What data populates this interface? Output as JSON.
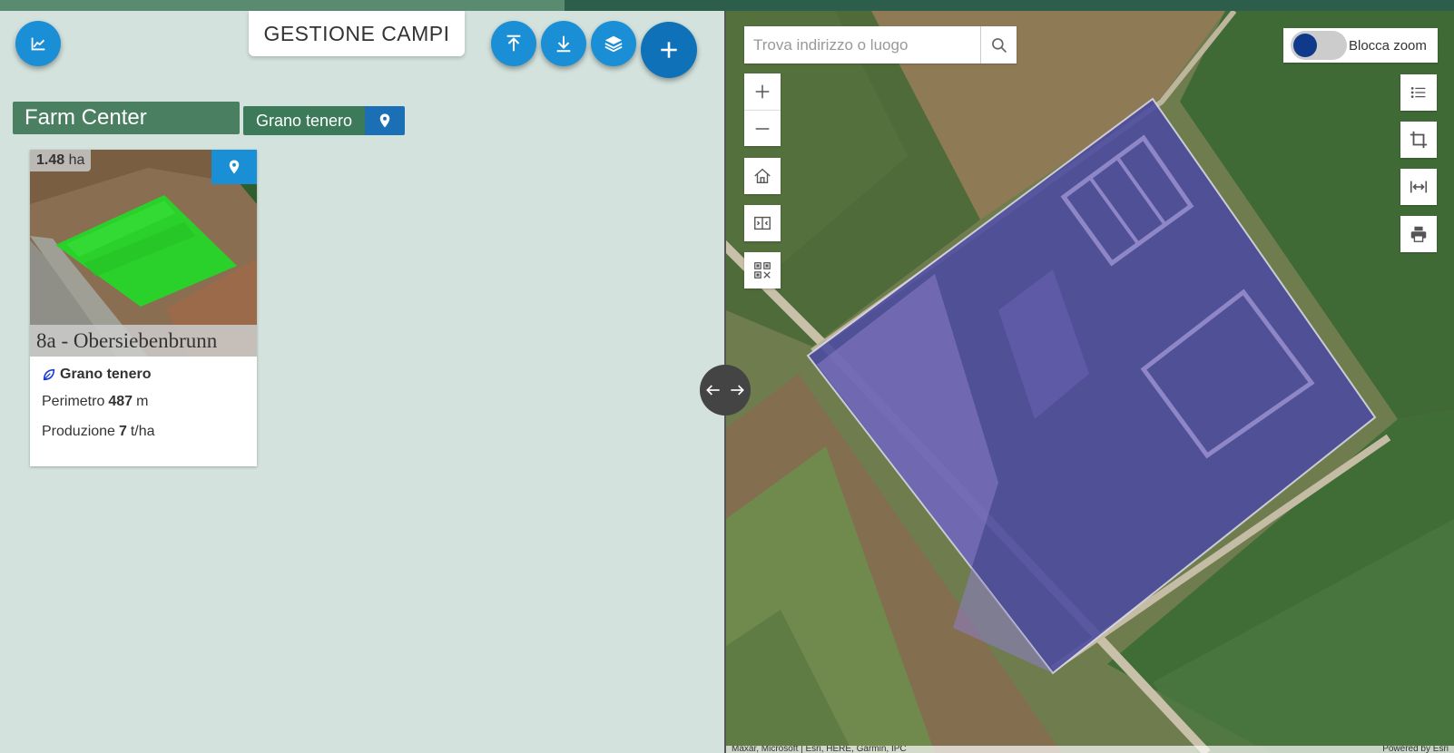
{
  "header": {
    "title": "GESTIONE CAMPI"
  },
  "toolbar": {
    "chart_icon": "chart-line-icon",
    "upload_icon": "upload-icon",
    "download_icon": "download-icon",
    "layers_icon": "layers-icon",
    "add_icon": "plus-icon"
  },
  "farm": {
    "name": "Farm Center"
  },
  "filter": {
    "crop_label": "Grano tenero"
  },
  "fields": [
    {
      "area_value": "1.48",
      "area_unit": "ha",
      "name": "8a - Obersiebenbrunn",
      "crop": "Grano tenero",
      "perimeter_label": "Perimetro",
      "perimeter_value": "487",
      "perimeter_unit": "m",
      "production_label": "Produzione",
      "production_value": "7",
      "production_unit": "t/ha"
    }
  ],
  "map": {
    "search_placeholder": "Trova indirizzo o luogo",
    "lock_zoom_label": "Blocca zoom",
    "lock_zoom_on": true,
    "attribution_left": "Maxar, Microsoft | Esri, HERE, Garmin, IPC",
    "attribution_right": "Powered by Esri"
  },
  "colors": {
    "accent": "#1a8fd6",
    "farm_green": "#4a7f62",
    "field_overlay": "#4b4aa0"
  }
}
